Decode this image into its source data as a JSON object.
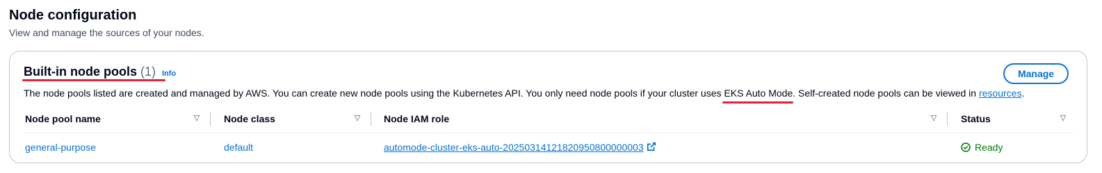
{
  "section": {
    "title": "Node configuration",
    "description": "View and manage the sources of your nodes."
  },
  "card": {
    "title": "Built-in node pools",
    "count": "(1)",
    "info_label": "Info",
    "manage_label": "Manage",
    "description_part1": "The node pools listed are created and managed by AWS. You can create new node pools using the Kubernetes API. You only need node pools if your cluster uses ",
    "description_highlight": "EKS Auto Mode",
    "description_part2": ". Self-created node pools can be viewed in ",
    "description_link": "resources",
    "description_end": ".",
    "annotation_color": "#e5213a"
  },
  "table": {
    "columns": [
      "Node pool name",
      "Node class",
      "Node IAM role",
      "Status"
    ],
    "rows": [
      {
        "node_pool_name": "general-purpose",
        "node_class": "default",
        "node_iam_role": "automode-cluster-eks-auto-20250314121820950800000003",
        "status": "Ready"
      }
    ]
  },
  "colors": {
    "link": "#0972d3",
    "success": "#037f0c"
  },
  "icons": {
    "sort": "caret-down-icon",
    "external": "external-link-icon",
    "status": "check-circle-icon"
  }
}
